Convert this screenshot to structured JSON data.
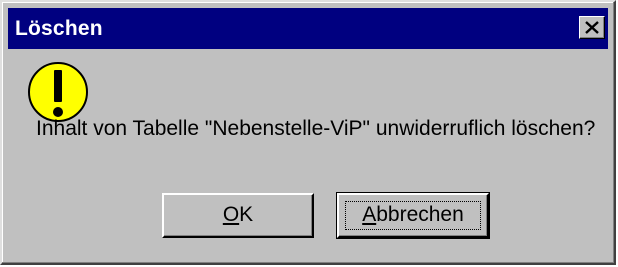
{
  "window": {
    "title": "Löschen",
    "close_glyph": "close-icon"
  },
  "icon": {
    "name": "warning-exclamation-icon",
    "color": "#ffff00",
    "border_color": "#000000"
  },
  "message": "Inhalt von Tabelle \"Nebenstelle-ViP\" unwiderruflich löschen?",
  "buttons": {
    "ok": {
      "mnemonic": "O",
      "rest": "K"
    },
    "cancel": {
      "mnemonic": "A",
      "rest": "bbrechen"
    }
  },
  "colors": {
    "titlebar": "#000080",
    "dialog_bg": "#c0c0c0"
  }
}
